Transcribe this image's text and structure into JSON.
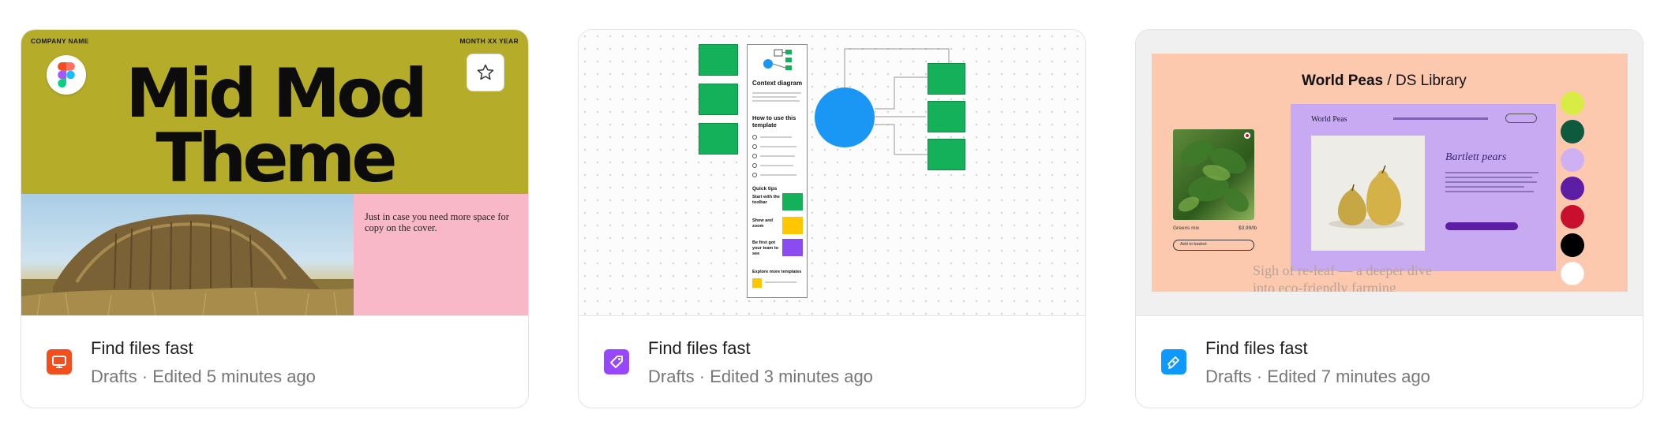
{
  "cards": [
    {
      "title": "Find files fast",
      "subtitle": "Drafts · Edited 5 minutes ago",
      "file_type_icon": "slides-icon",
      "icon_color": "#f24e1e",
      "thumbnail": {
        "company": "COMPANY NAME",
        "date": "MONTH XX YEAR",
        "headline_line1": "Mid Mod",
        "headline_line2": "Theme",
        "side_text": "Just in case you need more space for copy on the cover.",
        "bg_color": "#b5ad2a",
        "side_color": "#f9b8c8"
      },
      "badge_icon": "figma-logo-icon",
      "favorite_icon": "star-icon"
    },
    {
      "title": "Find files fast",
      "subtitle": "Drafts · Edited 3 minutes ago",
      "file_type_icon": "figjam-icon",
      "icon_color": "#9747ff",
      "thumbnail": {
        "doc_title": "Context diagram",
        "doc_section": "How to use this template",
        "doc_tips": "Quick tips",
        "tip1": "Start with the toolbar",
        "tip2": "Show and zoom",
        "tip3": "Be first got your team to see",
        "doc_footer": "Explore more templates",
        "sticky_color": "#14b05a",
        "circle_color": "#1a97f5"
      }
    },
    {
      "title": "Find files fast",
      "subtitle": "Drafts · Edited 7 minutes ago",
      "file_type_icon": "pen-tool-icon",
      "icon_color": "#0d99ff",
      "thumbnail": {
        "brand": "World Peas",
        "title_suffix": " / DS Library",
        "panel_brand": "World Peas",
        "product_title": "Bartlett pears",
        "product_label": "Greens mix",
        "product_price": "$3.99/lb",
        "add_label": "Add to basket",
        "caption_line1": "Sigh of re-leaf — a deeper dive",
        "caption_line2": "into eco-friendly farming",
        "bg_color": "#fcc9ae",
        "panel_color": "#c8aaf3",
        "swatches": [
          "#d9ec45",
          "#0e5a3f",
          "#cfb0f3",
          "#5d1ea6",
          "#c8102e",
          "#000000",
          "#ffffff"
        ]
      }
    }
  ]
}
